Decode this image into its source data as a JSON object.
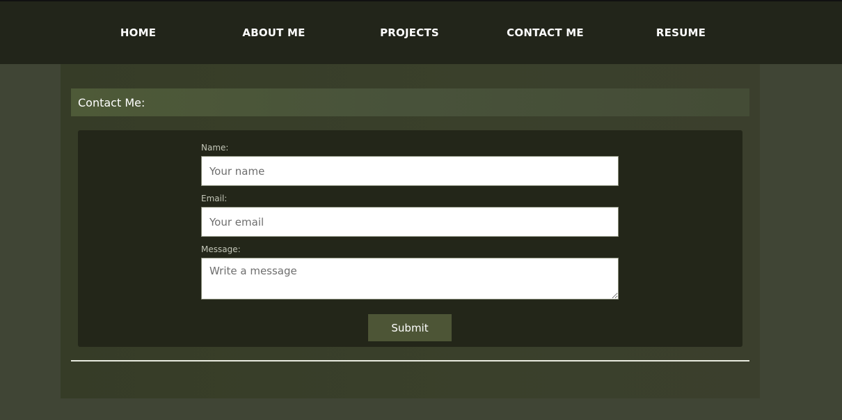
{
  "nav": {
    "items": [
      {
        "label": "HOME"
      },
      {
        "label": "ABOUT ME"
      },
      {
        "label": "PROJECTS"
      },
      {
        "label": "CONTACT ME"
      },
      {
        "label": "RESUME"
      }
    ]
  },
  "contact": {
    "header": "Contact Me:",
    "name_label": "Name:",
    "name_placeholder": "Your name",
    "email_label": "Email:",
    "email_placeholder": "Your email",
    "message_label": "Message:",
    "message_placeholder": "Write a message",
    "submit_label": "Submit"
  },
  "colors": {
    "page_background": "#404535",
    "navbar": "#22251a",
    "panel": "#383e29",
    "header_accent": "#4e5a38",
    "form_card": "#232619",
    "button": "#4d5536"
  }
}
